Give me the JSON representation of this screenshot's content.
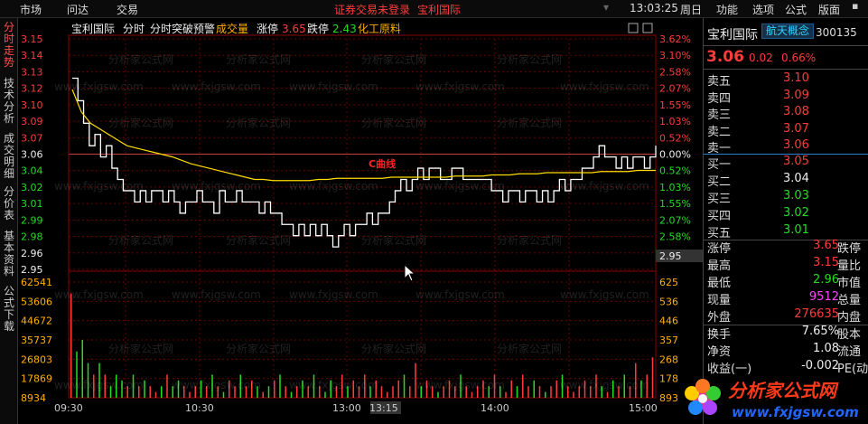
{
  "topbar": {
    "menu": [
      "市场",
      "问达",
      "交易"
    ],
    "status_login": "证券交易未登录",
    "status_stock": "宝利国际",
    "time": "13:03:25",
    "weekday": "周日",
    "right_menu": [
      "功能",
      "选项",
      "公式",
      "版面"
    ]
  },
  "sidebar": {
    "tabs": [
      "分时走势",
      "技术分析",
      "成交明细",
      "分价表",
      "基本资料",
      "公式下载"
    ],
    "active": "分时走势"
  },
  "chart_header": {
    "name": "宝利国际",
    "mode": "分时",
    "alert": "分时突破预警",
    "volume_label": "成交量",
    "limit_up_label": "涨停",
    "limit_up_value": "3.65",
    "limit_down_label": "跌停",
    "limit_down_value": "2.43",
    "sector": "化工原料"
  },
  "marker": "C曲线",
  "crosshair_price": "2.95",
  "chart_data": {
    "type": "line",
    "title": "宝利国际 分时",
    "x_ticks": [
      "09:30",
      "10:30",
      "13:00",
      "13:15",
      "14:00",
      "15:00"
    ],
    "price_ticks": [
      "3.15",
      "3.14",
      "3.13",
      "3.12",
      "3.10",
      "3.09",
      "3.07",
      "3.06",
      "3.04",
      "3.02",
      "3.01",
      "2.99",
      "2.98",
      "2.96",
      "2.95"
    ],
    "price_ticks_values": [
      3.15,
      3.135,
      3.12,
      3.105,
      3.1,
      3.085,
      3.07,
      3.06,
      3.04,
      3.025,
      3.01,
      2.995,
      2.98,
      2.965,
      2.95
    ],
    "pct_ticks": [
      "3.62%",
      "3.10%",
      "2.58%",
      "2.07%",
      "1.55%",
      "1.03%",
      "0.52%",
      "0.00%",
      "0.52%",
      "1.03%",
      "1.55%",
      "2.07%",
      "2.58%"
    ],
    "pct_ticks_colors": [
      "red",
      "red",
      "red",
      "red",
      "red",
      "red",
      "red",
      "white",
      "green",
      "green",
      "green",
      "green",
      "green"
    ],
    "volume_ticks": [
      "62541",
      "53606",
      "44672",
      "35737",
      "26803",
      "17869",
      "8934"
    ],
    "volume_right_ticks": [
      "625",
      "536",
      "446",
      "357",
      "268",
      "178",
      "893"
    ],
    "prev_close": 3.04,
    "price_range": [
      2.95,
      3.155
    ],
    "price_series": [
      3.12,
      3.1,
      3.08,
      3.06,
      3.07,
      3.05,
      3.06,
      3.04,
      3.03,
      3.02,
      3.02,
      3.01,
      3.02,
      3.01,
      3.02,
      3.02,
      3.01,
      3.02,
      3.01,
      3.0,
      3.01,
      3.01,
      3.02,
      3.01,
      3.01,
      3.0,
      3.02,
      3.01,
      3.01,
      3.02,
      3.01,
      3.01,
      3.01,
      3.0,
      3.01,
      3.0,
      3.0,
      2.99,
      2.99,
      2.98,
      2.99,
      2.98,
      2.99,
      2.98,
      2.99,
      2.98,
      2.97,
      2.98,
      2.99,
      2.98,
      2.99,
      2.99,
      3.0,
      2.99,
      3.0,
      3.0,
      3.01,
      3.02,
      3.03,
      3.02,
      3.03,
      3.04,
      3.03,
      3.04,
      3.04,
      3.03,
      3.03,
      3.04,
      3.04,
      3.03,
      3.03,
      3.03,
      3.03,
      3.03,
      3.02,
      3.02,
      3.01,
      3.02,
      3.02,
      3.01,
      3.02,
      3.02,
      3.01,
      3.02,
      3.01,
      3.02,
      3.03,
      3.02,
      3.03,
      3.03,
      3.04,
      3.04,
      3.05,
      3.06,
      3.05,
      3.05,
      3.04,
      3.05,
      3.04,
      3.05,
      3.05,
      3.04,
      3.05,
      3.06
    ],
    "avg_series": [
      3.11,
      3.09,
      3.08,
      3.075,
      3.07,
      3.065,
      3.06,
      3.058,
      3.056,
      3.054,
      3.052,
      3.05,
      3.047,
      3.044,
      3.042,
      3.04,
      3.038,
      3.036,
      3.034,
      3.032,
      3.03,
      3.03,
      3.029,
      3.029,
      3.029,
      3.029,
      3.029,
      3.03,
      3.03,
      3.031,
      3.031,
      3.031,
      3.031,
      3.031,
      3.031,
      3.032,
      3.032,
      3.032,
      3.032,
      3.032,
      3.032,
      3.032,
      3.033,
      3.033,
      3.033,
      3.033,
      3.034,
      3.034,
      3.034,
      3.035,
      3.035,
      3.035,
      3.036,
      3.036,
      3.036,
      3.036,
      3.036,
      3.036,
      3.037,
      3.037,
      3.037,
      3.037,
      3.038,
      3.038,
      3.038
    ],
    "volume_series": [
      0.9,
      0.4,
      0.5,
      0.3,
      0.2,
      0.3,
      0.2,
      0.1,
      0.2,
      0.15,
      0.1,
      0.2,
      0.1,
      0.15,
      0.1,
      0.05,
      0.1,
      0.2,
      0.1,
      0.15,
      0.1,
      0.05,
      0.1,
      0.15,
      0.1,
      0.2,
      0.1,
      0.05,
      0.15,
      0.1,
      0.2,
      0.1,
      0.15,
      0.1,
      0.05,
      0.1,
      0.15,
      0.2,
      0.1,
      0.05,
      0.1,
      0.15,
      0.1,
      0.2,
      0.1,
      0.05,
      0.15,
      0.1,
      0.2,
      0.1,
      0.15,
      0.1,
      0.2,
      0.1,
      0.15,
      0.1,
      0.05,
      0.1,
      0.15,
      0.2,
      0.1,
      0.3,
      0.1,
      0.15,
      0.1,
      0.05,
      0.1,
      0.15,
      0.1,
      0.2,
      0.1,
      0.05,
      0.1,
      0.15,
      0.1,
      0.2,
      0.1,
      0.05,
      0.15,
      0.1,
      0.2,
      0.1,
      0.15,
      0.1,
      0.05,
      0.1,
      0.15,
      0.2,
      0.1,
      0.05,
      0.1,
      0.15,
      0.1,
      0.2,
      0.1,
      0.05,
      0.15,
      0.1,
      0.2,
      0.1,
      0.3,
      0.15,
      0.2,
      0.35
    ],
    "colors": {
      "price": "#ffffff",
      "avg": "#ffdd00",
      "grid": "#8a0000",
      "up_vol": "#ff3b3b",
      "down_vol": "#22dd22"
    }
  },
  "quote": {
    "name": "宝利国际",
    "concept": "航天概念",
    "code": "300135",
    "price": "3.06",
    "change": "0.02",
    "change_pct": "0.66%",
    "asks": [
      {
        "label": "卖五",
        "price": "3.10"
      },
      {
        "label": "卖四",
        "price": "3.09"
      },
      {
        "label": "卖三",
        "price": "3.08"
      },
      {
        "label": "卖二",
        "price": "3.07"
      },
      {
        "label": "卖一",
        "price": "3.06"
      }
    ],
    "bids": [
      {
        "label": "买一",
        "price": "3.05"
      },
      {
        "label": "买二",
        "price": "3.04"
      },
      {
        "label": "买三",
        "price": "3.03"
      },
      {
        "label": "买四",
        "price": "3.02"
      },
      {
        "label": "买五",
        "price": "3.01"
      }
    ],
    "stats": [
      {
        "label": "涨停",
        "value": "3.65",
        "label2": "跌停",
        "color": "red"
      },
      {
        "label": "最高",
        "value": "3.15",
        "label2": "量比",
        "color": "red"
      },
      {
        "label": "最低",
        "value": "2.96",
        "label2": "市值",
        "color": "green"
      },
      {
        "label": "现量",
        "value": "9512",
        "label2": "总量",
        "color": "purple"
      },
      {
        "label": "外盘",
        "value": "276635",
        "label2": "内盘",
        "color": "red"
      },
      {
        "label": "换手",
        "value": "7.65%",
        "label2": "股本",
        "color": "white"
      },
      {
        "label": "净资",
        "value": "1.08",
        "label2": "流通",
        "color": "white"
      },
      {
        "label": "收益(一)",
        "value": "-0.002",
        "label2": "PE(动)",
        "color": "white"
      }
    ]
  },
  "watermark": {
    "text": "分析家公式网",
    "url": "www.fxjgsw.com"
  }
}
